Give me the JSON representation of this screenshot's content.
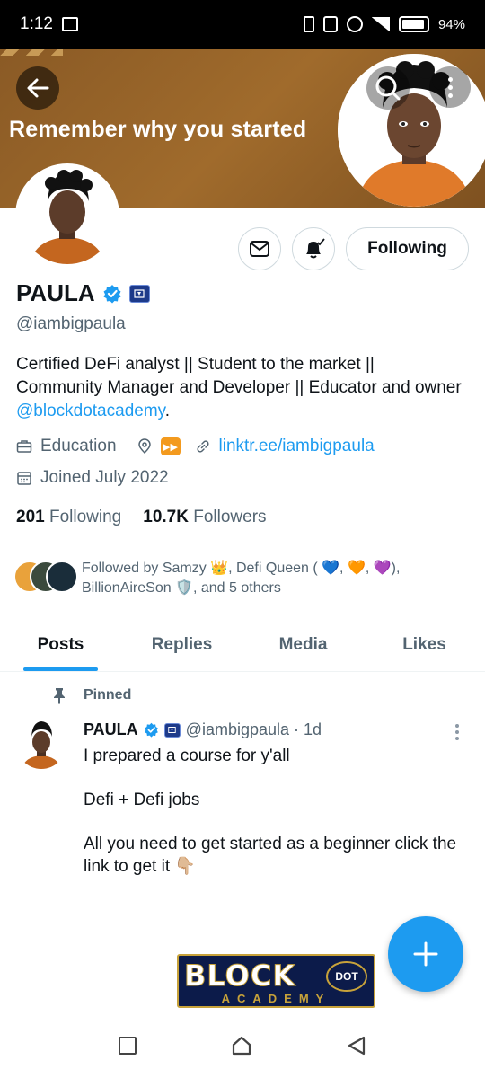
{
  "status_bar": {
    "time": "1:12",
    "battery": "94%"
  },
  "banner": {
    "text": "Remember why you started",
    "color": "#8a5a25"
  },
  "profile": {
    "name": "PAULA",
    "handle": "@iambigpaula",
    "bio_text": "Certified DeFi analyst || Student to the market || Community Manager and Developer || Educator and owner ",
    "bio_mention": "@blockdotacademy",
    "bio_end": ".",
    "category": "Education",
    "website": "linktr.ee/iambigpaula",
    "joined": "Joined July 2022",
    "following_count": "201",
    "following_label": "Following",
    "followers_count": "10.7K",
    "followers_label": "Followers",
    "followed_by": "Followed by Samzy 👑, Defi Queen ( 💙, 🧡, 💜), BillionAireSon 🛡️, and 5 others"
  },
  "actions": {
    "following_button": "Following"
  },
  "tabs": [
    {
      "label": "Posts",
      "active": true
    },
    {
      "label": "Replies",
      "active": false
    },
    {
      "label": "Media",
      "active": false
    },
    {
      "label": "Likes",
      "active": false
    }
  ],
  "post": {
    "pinned_label": "Pinned",
    "author": "PAULA",
    "handle_time": "@iambigpaula · 1d",
    "line1": "I prepared a course for y'all",
    "line2": "Defi + Defi jobs",
    "line3": "All you need to get started as a beginner click the link to get it 👇🏼"
  },
  "logo": {
    "word": "BLOCK",
    "dot": "DOT",
    "academy": "ACADEMY"
  },
  "colors": {
    "accent": "#1d9bf0",
    "text": "#0f1419",
    "muted": "#536471"
  }
}
